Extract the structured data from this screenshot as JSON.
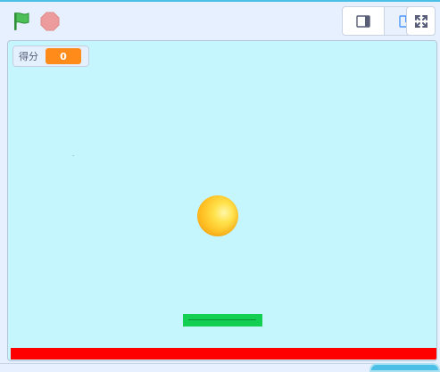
{
  "toolbar": {
    "green_flag_icon": "green-flag-icon",
    "stop_icon": "stop-sign-icon",
    "view_small_icon": "small-stage-icon",
    "view_large_icon": "large-stage-icon",
    "fullscreen_icon": "fullscreen-icon"
  },
  "stage": {
    "background_color": "#c5f6fd",
    "monitor": {
      "label": "得分",
      "value": "0"
    },
    "sprites": {
      "ball": {
        "color": "#ffbf22"
      },
      "paddle": {
        "color": "#14d052"
      },
      "floor": {
        "color": "#ff0000"
      }
    }
  },
  "colors": {
    "flag_green": "#4cbf56",
    "stop_red": "#ec9c9c",
    "monitor_orange": "#ff8c1a",
    "accent_blue": "#4cbfe6"
  }
}
